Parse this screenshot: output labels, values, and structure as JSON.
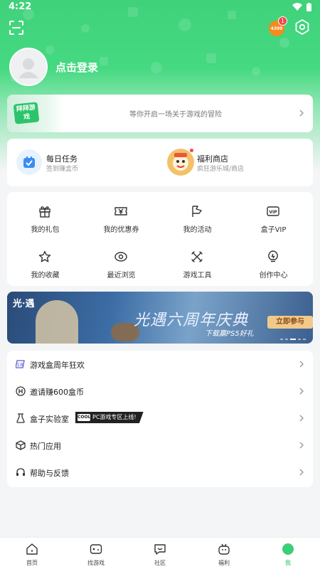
{
  "status_bar": {
    "time": "4:22"
  },
  "header": {
    "coin_text": "4399",
    "notification_count": "1"
  },
  "profile": {
    "login_label": "点击登录"
  },
  "adventure": {
    "logo_text": "拜拜游戏",
    "text": "等你开启一场关于游戏的冒险"
  },
  "tasks": [
    {
      "title": "每日任务",
      "subtitle": "签到赚盒币"
    },
    {
      "title": "福利商店",
      "subtitle": "疯狂游乐城/商店"
    }
  ],
  "shortcuts": [
    {
      "label": "我的礼包",
      "icon": "gift-icon"
    },
    {
      "label": "我的优惠券",
      "icon": "coupon-icon"
    },
    {
      "label": "我的活动",
      "icon": "flag-icon"
    },
    {
      "label": "盒子VIP",
      "icon": "vip-icon"
    },
    {
      "label": "我的收藏",
      "icon": "star-icon"
    },
    {
      "label": "最近浏览",
      "icon": "eye-icon"
    },
    {
      "label": "游戏工具",
      "icon": "tools-icon"
    },
    {
      "label": "创作中心",
      "icon": "bulb-icon"
    }
  ],
  "banner": {
    "logo": "光·遇",
    "title": "光遇六周年庆典",
    "subtitle": "下载赢PS5好礼",
    "cta": "立即参与"
  },
  "list": [
    {
      "label": "游戏盒周年狂欢",
      "icon": "anniversary-icon"
    },
    {
      "label": "邀请赚600盒币",
      "icon": "invite-coin-icon"
    },
    {
      "label": "盒子实验室",
      "icon": "lab-flask-icon",
      "tag": "PC游戏专区上线!",
      "tag_badge": "COOL"
    },
    {
      "label": "热门应用",
      "icon": "cube-icon"
    },
    {
      "label": "帮助与反馈",
      "icon": "headset-icon"
    }
  ],
  "tabbar": [
    {
      "label": "首页",
      "icon": "home-icon"
    },
    {
      "label": "找游戏",
      "icon": "gamepad-icon"
    },
    {
      "label": "社区",
      "icon": "chat-icon"
    },
    {
      "label": "福利",
      "icon": "gift-box-icon"
    },
    {
      "label": "我",
      "icon": "me-icon",
      "active": true
    }
  ],
  "colors": {
    "brand": "#3fd27a",
    "accent_active": "#2bc46a",
    "badge": "#f04848",
    "coin": "#f58a1f"
  }
}
